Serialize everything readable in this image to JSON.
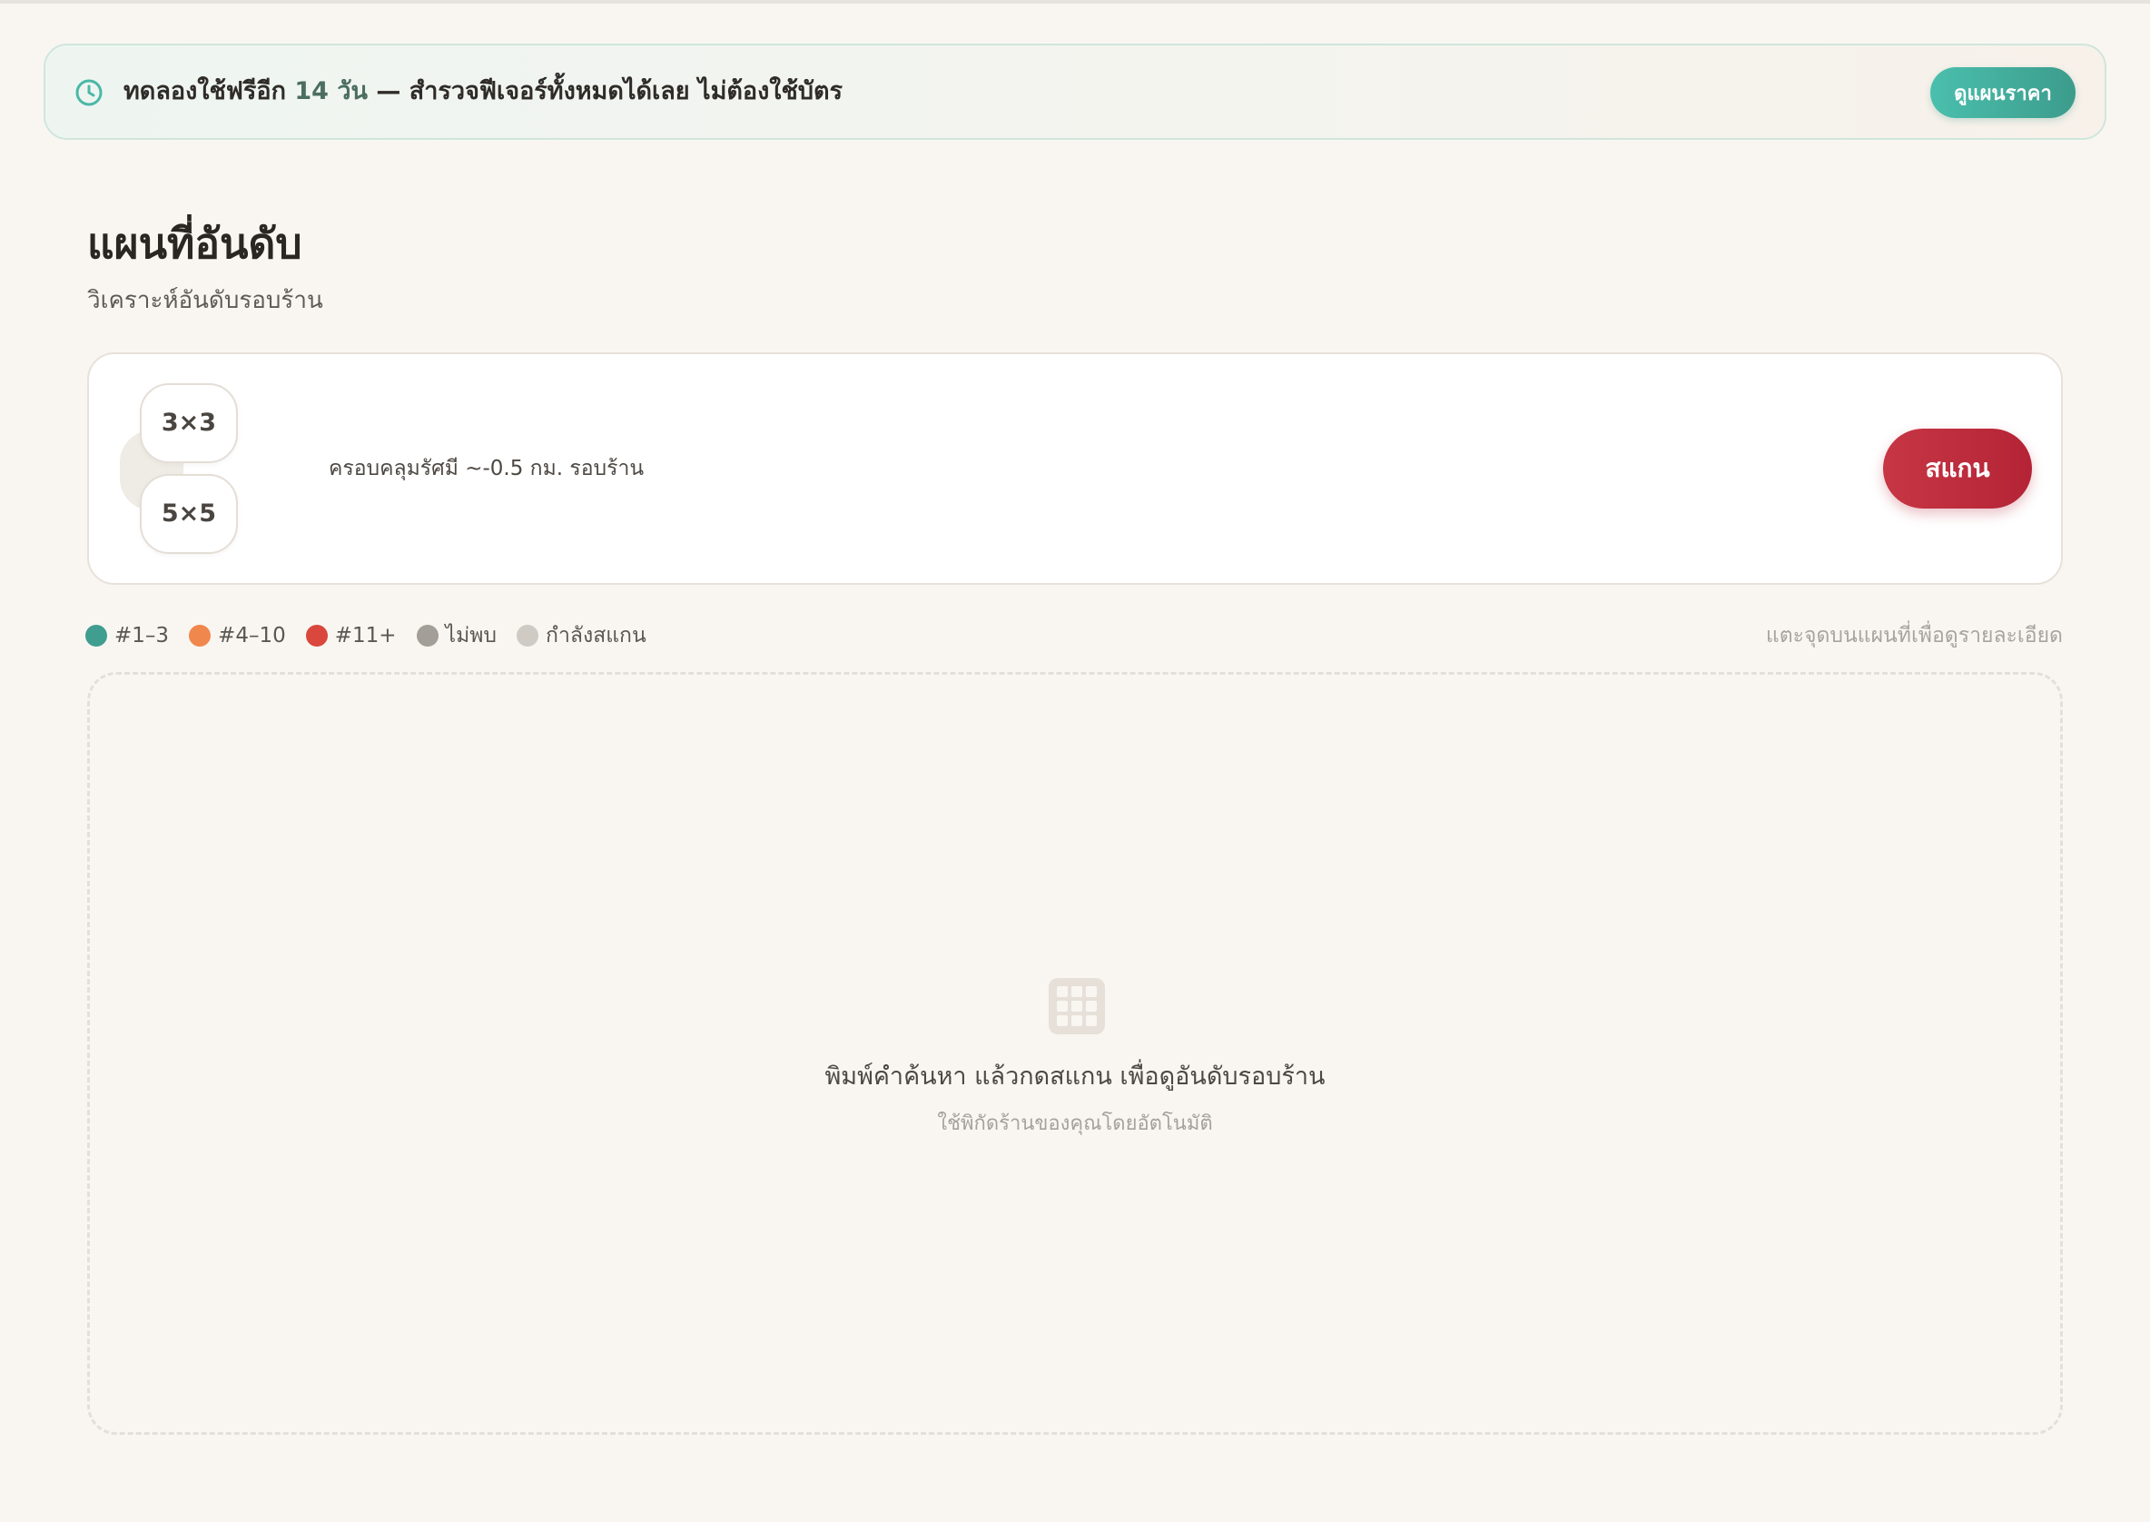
{
  "trial_banner": {
    "text_before": "ทดลองใช้ฟรีอีก",
    "days": "14 วัน",
    "text_after": "— สำรวจฟีเจอร์ทั้งหมดได้เลย ไม่ต้องใช้บัตร",
    "button_label": "ดูแผนราคา"
  },
  "header": {
    "title": "แผนที่อันดับ",
    "subtitle": "วิเคราะห์อันดับรอบร้าน"
  },
  "scan": {
    "grid_options": [
      "3×3",
      "5×5"
    ],
    "coverage": "ครอบคลุมรัศมี ~-0.5 กม. รอบร้าน",
    "button_label": "สแกน"
  },
  "legend": {
    "items": [
      {
        "label": "#1–3",
        "color": "#3f9e8f"
      },
      {
        "label": "#4–10",
        "color": "#f0874d"
      },
      {
        "label": "#11+",
        "color": "#d9473d"
      },
      {
        "label": "ไม่พบ",
        "color": "#a39e98"
      },
      {
        "label": "กำลังสแกน",
        "color": "#cfcac4"
      }
    ],
    "hint": "แตะจุดบนแผนที่เพื่อดูรายละเอียด"
  },
  "map": {
    "icon": "grid-icon",
    "empty_title": "พิมพ์คำค้นหา แล้วกดสแกน เพื่อดูอันดับรอบร้าน",
    "empty_subtitle": "ใช้พิกัดร้านของคุณโดยอัตโนมัติ"
  }
}
